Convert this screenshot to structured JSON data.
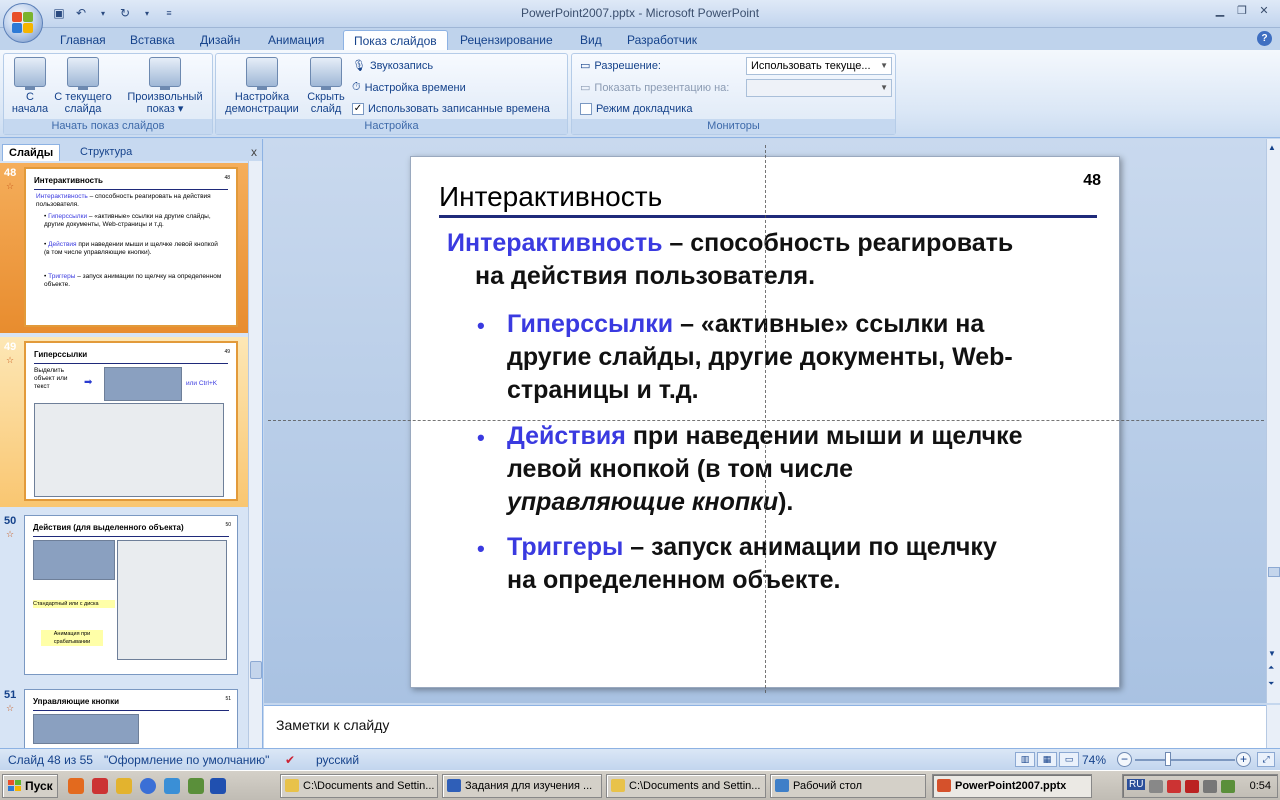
{
  "window": {
    "title": "PowerPoint2007.pptx - Microsoft PowerPoint"
  },
  "tabs": [
    "Главная",
    "Вставка",
    "Дизайн",
    "Анимация",
    "Показ слайдов",
    "Рецензирование",
    "Вид",
    "Разработчик"
  ],
  "active_tab": "Показ слайдов",
  "ribbon": {
    "group_start": {
      "label": "Начать показ слайдов",
      "from_start": "С\nначала",
      "from_current": "С текущего\nслайда",
      "custom": "Произвольный\nпоказ ▾"
    },
    "group_setup": {
      "label": "Настройка",
      "setup_show": "Настройка\nдемонстрации",
      "hide_slide": "Скрыть\nслайд",
      "record": "Звукозапись",
      "timings": "Настройка времени",
      "use_timings": "Использовать записанные времена",
      "use_timings_checked": true
    },
    "group_monitors": {
      "label": "Мониторы",
      "resolution_label": "Разрешение:",
      "resolution_value": "Использовать текуще...",
      "show_on_label": "Показать презентацию на:",
      "show_on_value": "",
      "presenter_view": "Режим докладчика",
      "presenter_view_checked": false
    }
  },
  "left_pane": {
    "tab_slides": "Слайды",
    "tab_outline": "Структура",
    "close": "x",
    "slides": [
      {
        "num": "48",
        "title": "Интерактивность",
        "page": "48",
        "lines": [
          {
            "blue": "Интерактивность",
            "text": " – способность реагировать на действия пользователя."
          },
          {
            "blue": "Гиперссылки",
            "text": " – «активные» ссылки на другие слайды, другие документы, Web-страницы и т.д."
          },
          {
            "blue": "Действия",
            "text": " при наведении мыши и щелчке левой кнопкой (в том числе управляющие кнопки)."
          },
          {
            "blue": "Триггеры",
            "text": " – запуск анимации по щелчку на определенном объекте."
          }
        ]
      },
      {
        "num": "49",
        "title": "Гиперссылки",
        "page": "49",
        "caption": "Выделить объект или текст",
        "shortcut": "или Ctrl+K"
      },
      {
        "num": "50",
        "title": "Действия (для выделенного объекта)",
        "page": "50",
        "note1": "Стандартный или с диска",
        "note2": "Анимация при срабатывании"
      },
      {
        "num": "51",
        "title": "Управляющие кнопки",
        "page": "51"
      }
    ]
  },
  "slide": {
    "title": "Интерактивность",
    "page_number": "48",
    "intro_term": "Интерактивность",
    "intro_line1": " – способность реагировать",
    "intro_line2": "на действия пользователя.",
    "bullets": [
      {
        "term": "Гиперссылки",
        "line1": " – «активные» ссылки на",
        "line2": "другие слайды, другие документы, Web-",
        "line3": "страницы и т.д."
      },
      {
        "term": "Действия",
        "line1": " при наведении мыши и щелчке",
        "line2": "левой кнопкой (в том числе",
        "line3_em": "управляющие кнопки",
        "line3_tail": ")."
      },
      {
        "term": "Триггеры",
        "line1": " – запуск анимации по щелчку",
        "line2": "на определенном объекте."
      }
    ]
  },
  "notes": {
    "placeholder": "Заметки к слайду"
  },
  "status": {
    "slide_of": "Слайд 48 из 55",
    "theme": "\"Оформление по умолчанию\"",
    "language": "русский",
    "zoom": "74%"
  },
  "taskbar": {
    "start": "Пуск",
    "tasks": [
      "C:\\Documents and Settin...",
      "Задания для изучения ...",
      "C:\\Documents and Settin...",
      "Рабочий стол",
      "PowerPoint2007.pptx"
    ],
    "lang": "RU",
    "time": "0:54"
  }
}
